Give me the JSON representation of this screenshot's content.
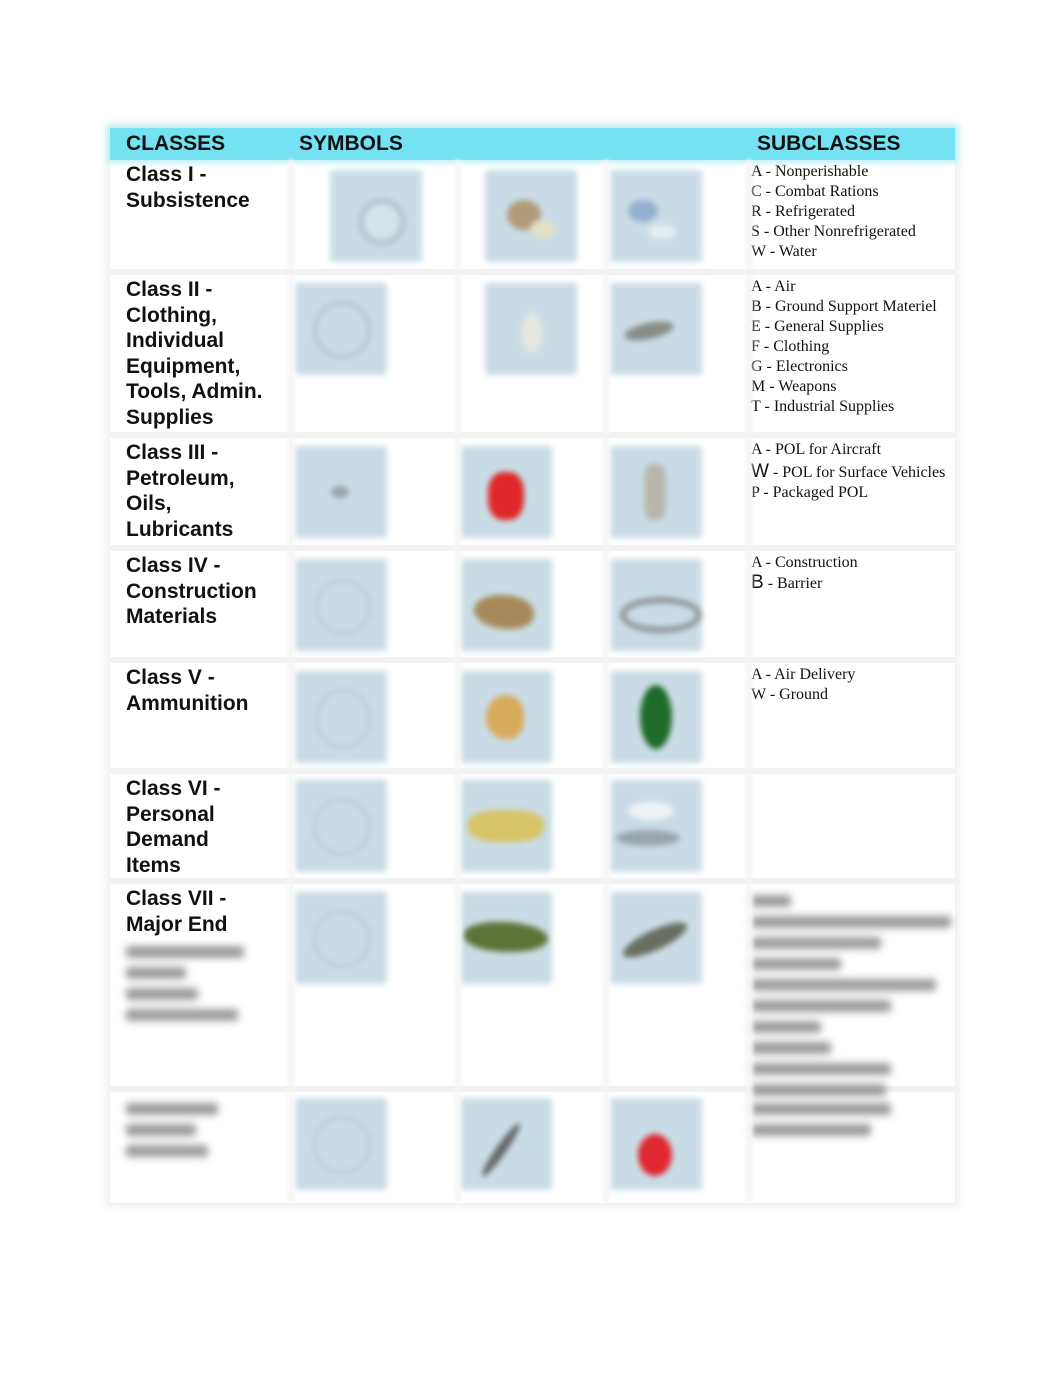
{
  "header": {
    "classes": "CLASSES",
    "symbols": "SYMBOLS",
    "subclasses": "SUBCLASSES"
  },
  "colors": {
    "header_bg": "#74e2f2",
    "symbol_bg": "#c9dce5"
  },
  "rows": [
    {
      "class_lines": [
        "Class I -",
        "Subsistence"
      ],
      "symbols": [
        "map-symbol-icon",
        "food-icon",
        "water-icon"
      ],
      "subclasses": [
        "A - Nonperishable",
        "C - Combat Rations",
        "R - Refrigerated",
        "S - Other Nonrefrigerated",
        "W - Water"
      ]
    },
    {
      "class_lines": [
        "Class II -",
        "Clothing,",
        "Individual",
        "Equipment,",
        "Tools, Admin.",
        "Supplies"
      ],
      "symbols": [
        "map-symbol-icon",
        "clothing-icon",
        "tools-icon"
      ],
      "subclasses": [
        "A - Air",
        "B - Ground Support Materiel",
        "E - General Supplies",
        "F - Clothing",
        "G - Electronics",
        "M - Weapons",
        "T - Industrial Supplies"
      ]
    },
    {
      "class_lines": [
        "Class III -",
        "Petroleum,",
        "Oils,",
        "Lubricants"
      ],
      "symbols": [
        "map-symbol-icon",
        "fuel-can-icon",
        "oil-drum-icon"
      ],
      "subclasses": [
        {
          "code": "A",
          "text": " - POL for Aircraft"
        },
        {
          "code": "W",
          "text": " - POL for Surface Vehicles"
        },
        {
          "code": "P",
          "text": " - Packaged POL"
        }
      ]
    },
    {
      "class_lines": [
        "Class IV -",
        "Construction",
        "Materials"
      ],
      "symbols": [
        "map-symbol-icon",
        "lumber-icon",
        "barbed-wire-icon"
      ],
      "subclasses": [
        {
          "code": "A",
          "text": " - Construction"
        },
        {
          "code": "B",
          "text": " - Barrier"
        }
      ]
    },
    {
      "class_lines": [
        "Class V -",
        "Ammunition"
      ],
      "symbols": [
        "map-symbol-icon",
        "ammo-icon",
        "grenade-icon"
      ],
      "subclasses": [
        "A - Air Delivery",
        "W - Ground"
      ]
    },
    {
      "class_lines": [
        "Class VI -",
        "Personal",
        "Demand",
        "Items"
      ],
      "symbols": [
        "map-symbol-icon",
        "personal-items-icon",
        "shoe-icon"
      ],
      "subclasses": []
    },
    {
      "class_lines": [
        "Class VII -",
        "Major End"
      ],
      "symbols": [
        "map-symbol-icon",
        "tank-icon",
        "aircraft-icon"
      ],
      "subclasses": []
    },
    {
      "class_lines": [],
      "symbols": [
        "map-symbol-icon",
        "syringe-icon",
        "medical-bag-icon"
      ],
      "subclasses": []
    }
  ]
}
